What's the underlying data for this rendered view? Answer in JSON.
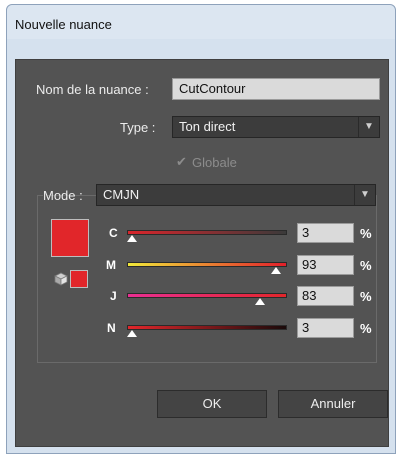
{
  "window": {
    "title": "Nouvelle nuance"
  },
  "name": {
    "label": "Nom de la nuance :",
    "value": "CutContour"
  },
  "type": {
    "label": "Type :",
    "value": "Ton direct"
  },
  "global": {
    "label": "Globale",
    "checked": true,
    "enabled": false
  },
  "mode": {
    "label": "Mode :",
    "value": "CMJN"
  },
  "channels": [
    {
      "label": "C",
      "value": "3",
      "fraction": 0.03
    },
    {
      "label": "M",
      "value": "93",
      "fraction": 0.93
    },
    {
      "label": "J",
      "value": "83",
      "fraction": 0.83
    },
    {
      "label": "N",
      "value": "3",
      "fraction": 0.03
    }
  ],
  "percent_symbol": "%",
  "buttons": {
    "ok": "OK",
    "cancel": "Annuler"
  },
  "colors": {
    "swatch": "#e1262a",
    "panel": "#535353"
  }
}
